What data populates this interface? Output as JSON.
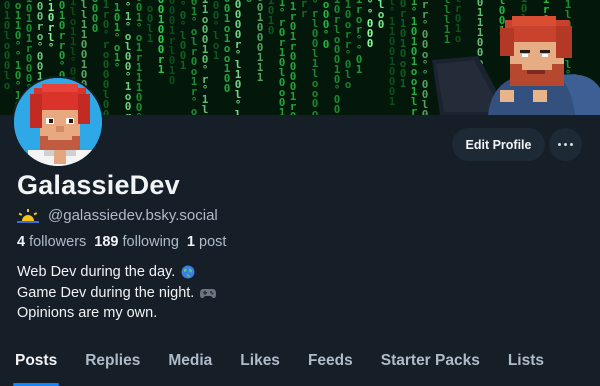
{
  "profile": {
    "display_name": "GalassieDev",
    "handle": "@galassiedev.bsky.social",
    "handle_icon": "sun-horizon-icon",
    "stats": {
      "followers_count": "4",
      "followers_label": "followers",
      "following_count": "189",
      "following_label": "following",
      "posts_count": "1",
      "posts_label": "post"
    },
    "bio": [
      {
        "text": "Web Dev during the day. ",
        "icon": "globe-icon"
      },
      {
        "text": "Game Dev during the night. ",
        "icon": "gamepad-icon"
      },
      {
        "text": "Opinions are my own.",
        "icon": ""
      }
    ]
  },
  "actions": {
    "edit_profile_label": "Edit Profile",
    "more_icon": "ellipsis-icon"
  },
  "tabs": [
    {
      "label": "Posts",
      "active": true
    },
    {
      "label": "Replies",
      "active": false
    },
    {
      "label": "Media",
      "active": false
    },
    {
      "label": "Likes",
      "active": false
    },
    {
      "label": "Feeds",
      "active": false
    },
    {
      "label": "Starter Packs",
      "active": false
    },
    {
      "label": "Lists",
      "active": false
    }
  ],
  "colors": {
    "background": "#161e27",
    "accent": "#1185fe",
    "button_bg": "#1e2936",
    "muted_text": "#aebbc9",
    "banner_green": "#2bff55"
  }
}
